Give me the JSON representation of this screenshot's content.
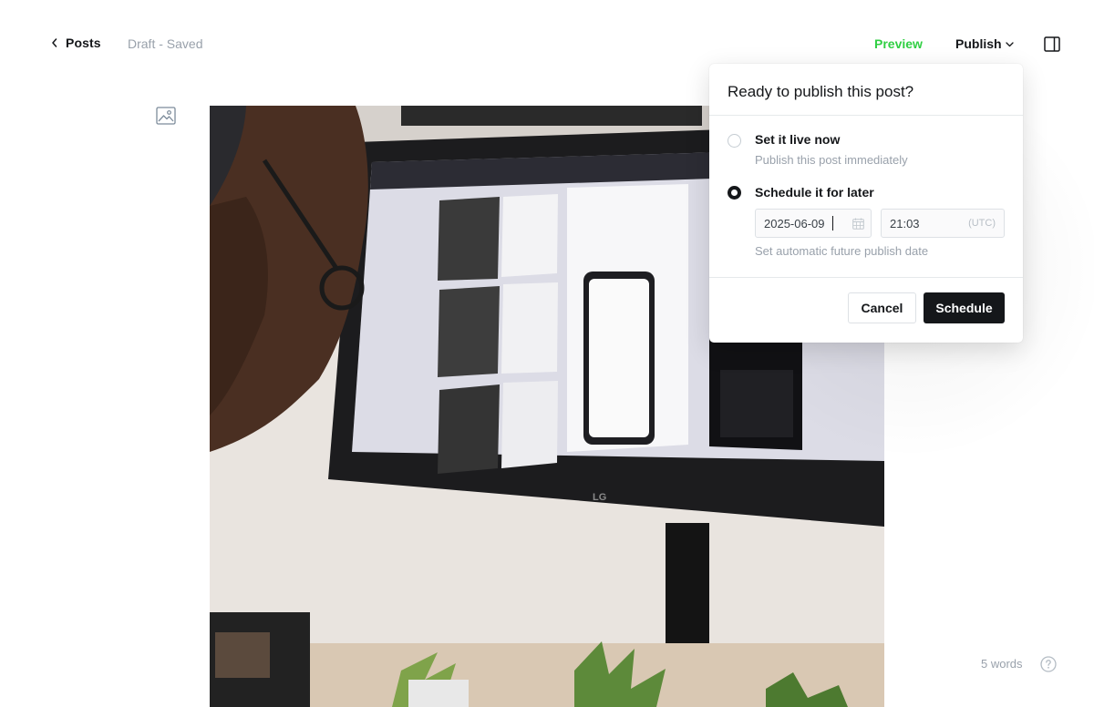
{
  "header": {
    "back_label": "Posts",
    "status": "Draft - Saved",
    "preview_label": "Preview",
    "publish_label": "Publish"
  },
  "publish_popover": {
    "title": "Ready to publish this post?",
    "options": [
      {
        "label": "Set it live now",
        "description": "Publish this post immediately",
        "selected": false
      },
      {
        "label": "Schedule it for later",
        "description": "Set automatic future publish date",
        "selected": true
      }
    ],
    "date_value": "2025-06-09",
    "time_value": "21:03",
    "timezone": "(UTC)",
    "cancel_label": "Cancel",
    "schedule_label": "Schedule"
  },
  "editor": {
    "word_count": "5 words"
  },
  "colors": {
    "accent_green": "#30cf43",
    "text_dark": "#15171a",
    "text_muted": "#99a1ab",
    "button_dark": "#15171a"
  },
  "icons": {
    "back": "chevron-left-icon",
    "publish_menu": "chevron-down-icon",
    "sidebar": "sidebar-panel-icon",
    "image": "image-icon",
    "calendar": "calendar-icon",
    "help": "question-mark-icon"
  }
}
